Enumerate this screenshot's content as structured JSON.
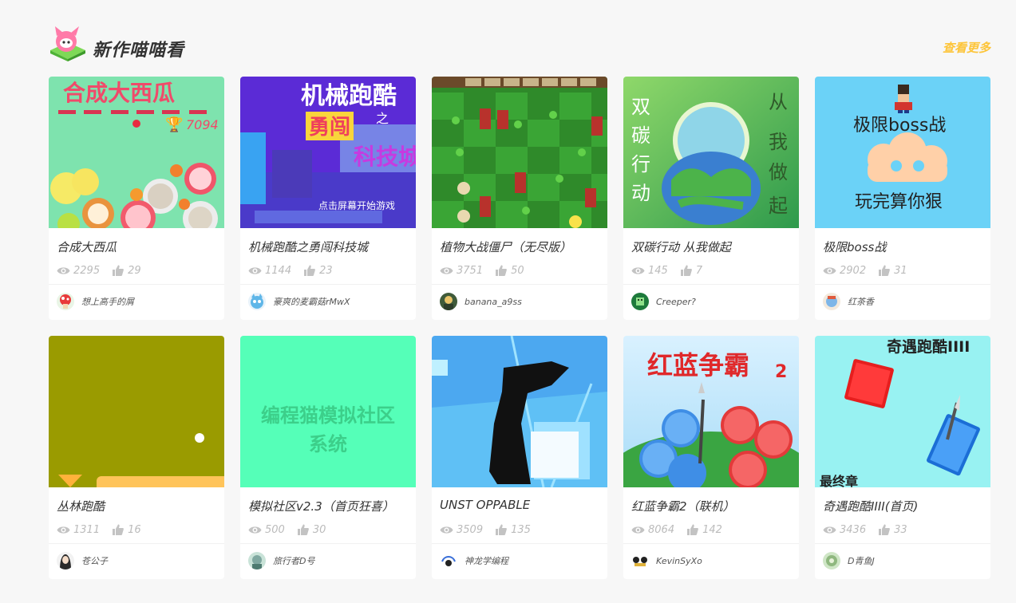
{
  "header": {
    "title": "新作喵喵看",
    "more_label": "查看更多"
  },
  "cards": [
    {
      "name": "合成大西瓜",
      "views": "2295",
      "likes": "29",
      "author": "想上高手的屑",
      "thumb_text": [
        "合成大西瓜",
        "7094"
      ]
    },
    {
      "name": "机械跑酷之勇闯科技城",
      "views": "1144",
      "likes": "23",
      "author": "豪爽的麦霸菇rMwX",
      "thumb_text": [
        "机械跑酷",
        "之",
        "勇闯",
        "科技城",
        "点击屏幕开始游戏"
      ]
    },
    {
      "name": "植物大战僵尸（无尽版）",
      "views": "3751",
      "likes": "50",
      "author": "banana_a9ss",
      "thumb_text": []
    },
    {
      "name": "双碳行动 从我做起",
      "views": "145",
      "likes": "7",
      "author": "Creeper?",
      "thumb_text": [
        "双",
        "碳",
        "行",
        "动",
        "从",
        "我",
        "做",
        "起"
      ]
    },
    {
      "name": "极限boss战",
      "views": "2902",
      "likes": "31",
      "author": "红茶香",
      "thumb_text": [
        "极限boss战",
        "玩完算你狠"
      ]
    },
    {
      "name": "丛林跑酷",
      "views": "1311",
      "likes": "16",
      "author": "苍公子",
      "thumb_text": []
    },
    {
      "name": "模拟社区v2.3（首页狂喜）",
      "views": "500",
      "likes": "30",
      "author": "旅行者D号",
      "thumb_text": [
        "编程猫模拟社区",
        "系统"
      ]
    },
    {
      "name": "UNST OPPABLE",
      "views": "3509",
      "likes": "135",
      "author": "神龙学编程",
      "thumb_text": []
    },
    {
      "name": "红蓝争霸2（联机）",
      "views": "8064",
      "likes": "142",
      "author": "KevinSyXo",
      "thumb_text": [
        "红蓝争霸",
        "2"
      ]
    },
    {
      "name": "奇遇跑酷IIII(首页)",
      "views": "3436",
      "likes": "33",
      "author": "D青鱼J",
      "thumb_text": [
        "奇遇跑酷IIII",
        "最终章"
      ]
    }
  ],
  "colors": {
    "accent": "#fdc53a",
    "text": "#333333",
    "meta": "#bbbbbb",
    "bg": "#f7f7f7"
  },
  "icons": {
    "views": "eye-icon",
    "likes": "thumbs-up-icon",
    "logo": "cat-logo-icon"
  }
}
